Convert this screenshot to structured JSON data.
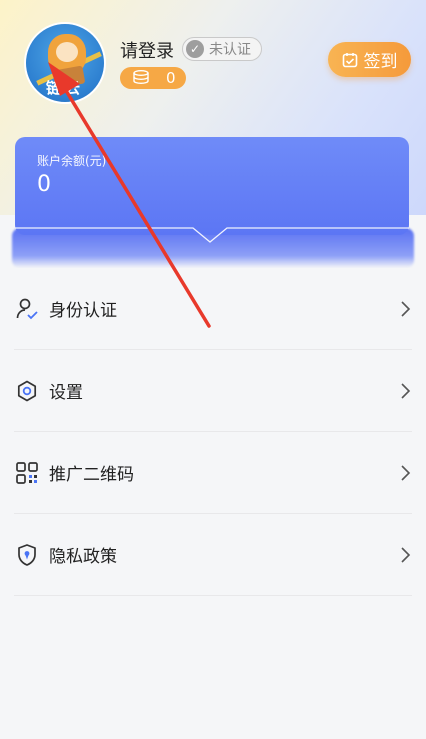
{
  "profile": {
    "avatar_text": "链云",
    "login_label": "请登录",
    "verify_status": "未认证",
    "points": "0",
    "signin_label": "签到"
  },
  "balance": {
    "label": "账户余额(元)",
    "value": "0"
  },
  "menu": {
    "items": [
      {
        "label": "身份认证",
        "icon": "user-check-icon"
      },
      {
        "label": "设置",
        "icon": "gear-icon"
      },
      {
        "label": "推广二维码",
        "icon": "qr-code-icon"
      },
      {
        "label": "隐私政策",
        "icon": "shield-icon"
      }
    ]
  },
  "colors": {
    "accent_orange": "#f6a845",
    "card_blue": "#5c76f4",
    "arrow_red": "#e8392b"
  }
}
